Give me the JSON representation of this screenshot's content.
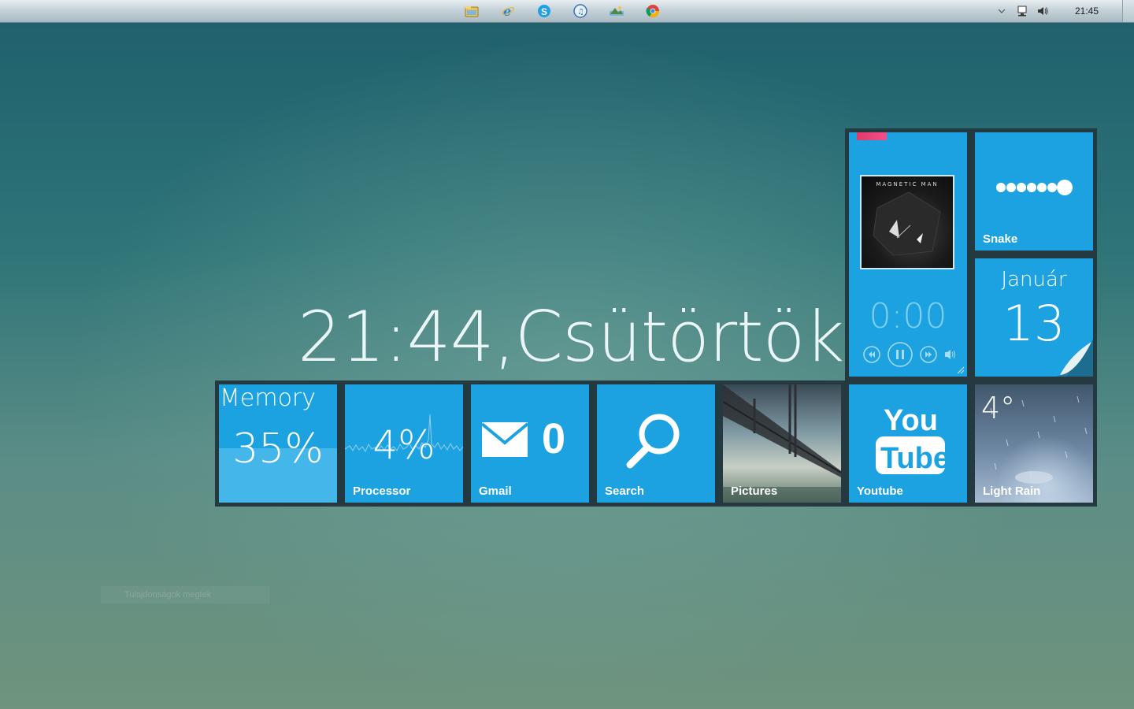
{
  "taskbar": {
    "apps": [
      {
        "name": "explorer-icon"
      },
      {
        "name": "internet-explorer-icon"
      },
      {
        "name": "skype-icon"
      },
      {
        "name": "itunes-icon"
      },
      {
        "name": "photo-gallery-icon"
      },
      {
        "name": "chrome-icon"
      }
    ],
    "tray": [
      "show-hidden-icons-chevron",
      "network-icon",
      "volume-icon"
    ],
    "clock": "21:45"
  },
  "desktop": {
    "big_time": "21:44,Csütörtök",
    "faint_field_text": "Tulajdonságok megtek"
  },
  "tiles": {
    "music": {
      "album_text": "MAGNETIC MAN",
      "time": "0:00",
      "controls": [
        "rewind-icon",
        "pause-icon",
        "fast-forward-icon",
        "volume-icon"
      ],
      "accent_color": "#e8407a"
    },
    "snake": {
      "label": "Snake"
    },
    "calendar": {
      "month": "Január",
      "day": "13"
    },
    "memory": {
      "title": "Memory",
      "value": "35%",
      "usage_fraction": 0.35
    },
    "processor": {
      "value": "4%",
      "label": "Processor"
    },
    "gmail": {
      "count": "0",
      "label": "Gmail"
    },
    "search": {
      "label": "Search"
    },
    "pictures": {
      "label": "Pictures"
    },
    "youtube": {
      "label": "Youtube",
      "logo_top": "You",
      "logo_bottom": "Tube"
    },
    "weather": {
      "temp": "4°",
      "label": "Light Rain"
    }
  },
  "colors": {
    "tile_blue": "#1da2e1",
    "frame": "#243a40",
    "text": "#ffffff"
  }
}
